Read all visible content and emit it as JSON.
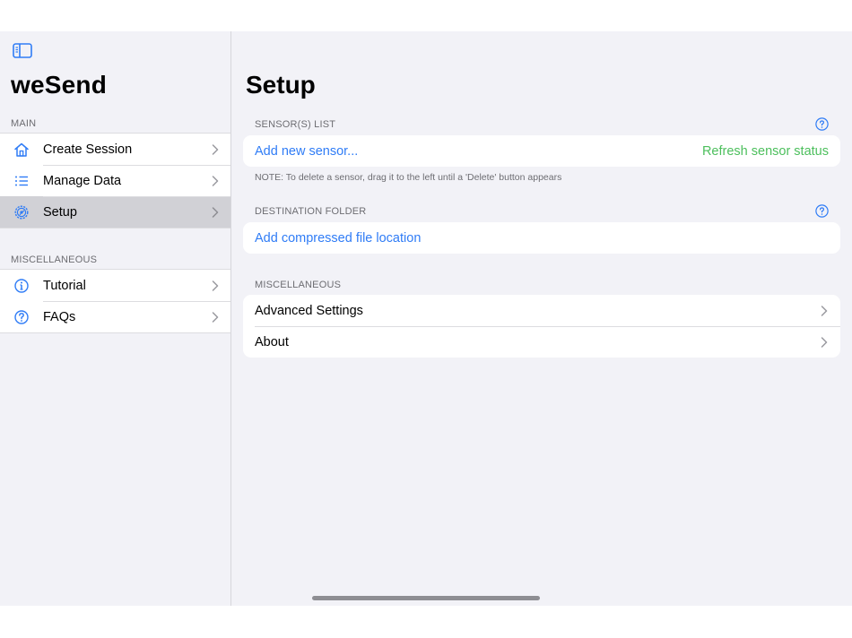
{
  "app": {
    "title": "weSend"
  },
  "sidebar": {
    "sections": [
      {
        "header": "MAIN",
        "items": [
          {
            "label": "Create Session",
            "icon": "house-icon",
            "selected": false
          },
          {
            "label": "Manage Data",
            "icon": "list-icon",
            "selected": false
          },
          {
            "label": "Setup",
            "icon": "gear-icon",
            "selected": true
          }
        ]
      },
      {
        "header": "MISCELLANEOUS",
        "items": [
          {
            "label": "Tutorial",
            "icon": "info-icon",
            "selected": false
          },
          {
            "label": "FAQs",
            "icon": "question-icon",
            "selected": false
          }
        ]
      }
    ]
  },
  "main": {
    "title": "Setup",
    "sensors": {
      "header": "SENSOR(S) LIST",
      "add_label": "Add new sensor...",
      "refresh_label": "Refresh sensor status",
      "note": "NOTE: To delete a sensor, drag it to the left until a 'Delete' button appears"
    },
    "destination": {
      "header": "DESTINATION FOLDER",
      "add_label": "Add compressed file location"
    },
    "misc": {
      "header": "MISCELLANEOUS",
      "items": [
        "Advanced Settings",
        "About"
      ]
    }
  },
  "colors": {
    "accent": "#2f7cf6",
    "success": "#4cbf5c",
    "background": "#f2f2f7",
    "selected": "#d1d1d6"
  }
}
